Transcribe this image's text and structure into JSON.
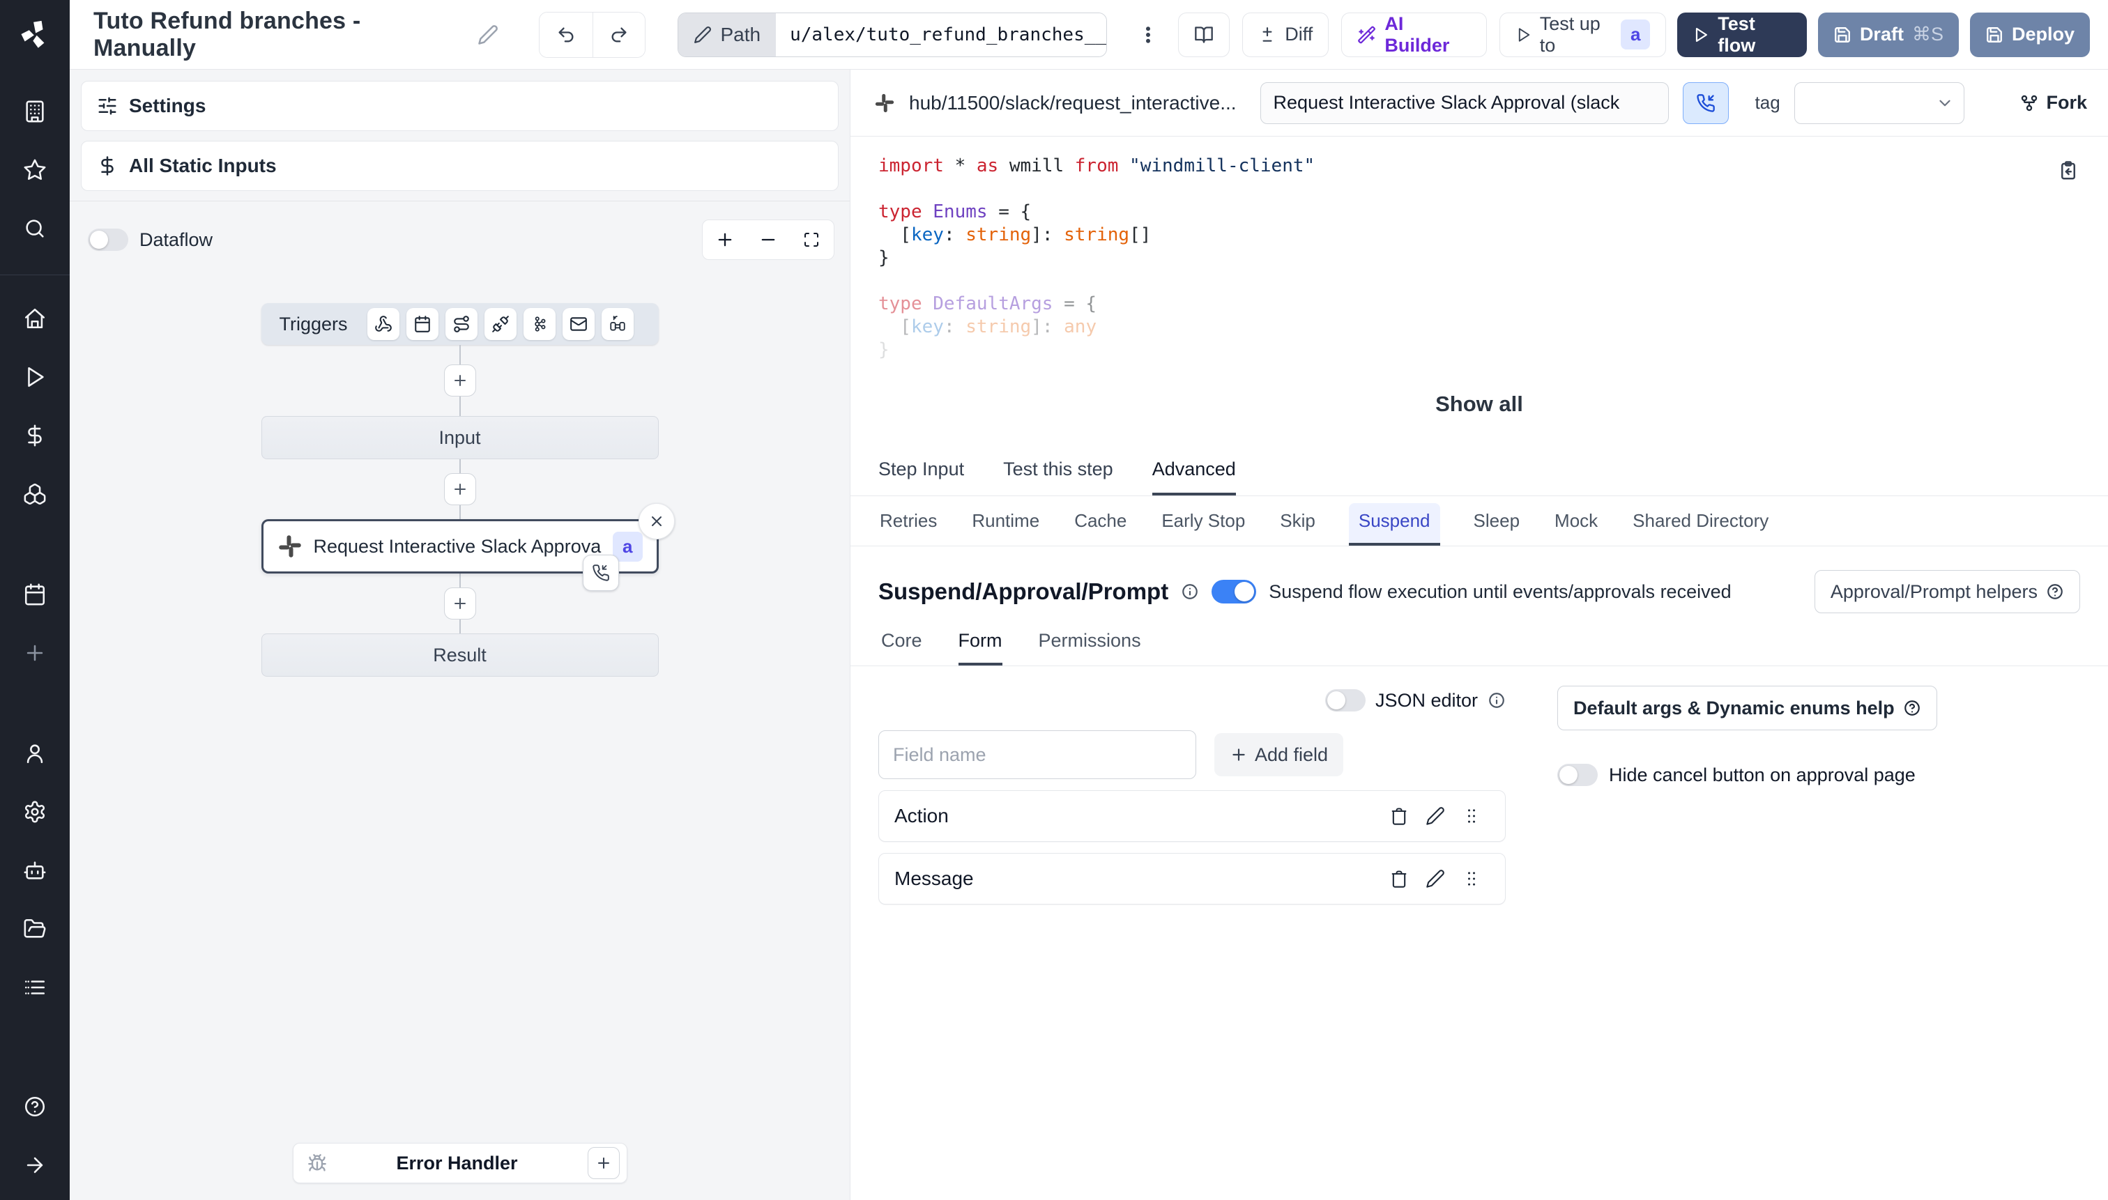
{
  "topbar": {
    "title": "Tuto Refund branches - Manually",
    "path_label": "Path",
    "path_value": "u/alex/tuto_refund_branches__",
    "diff_label": "Diff",
    "ai_builder_label": "AI Builder",
    "test_up_to_label": "Test up to",
    "test_up_to_badge": "a",
    "test_flow_label": "Test flow",
    "draft_label": "Draft",
    "draft_shortcut": "⌘S",
    "deploy_label": "Deploy"
  },
  "flow_panel": {
    "settings_label": "Settings",
    "all_static_inputs_label": "All Static Inputs",
    "dataflow_label": "Dataflow",
    "triggers_label": "Triggers",
    "input_node_label": "Input",
    "step_node_label": "Request Interactive Slack Approval (...",
    "step_node_badge": "a",
    "result_node_label": "Result",
    "error_handler_label": "Error Handler"
  },
  "step_panel": {
    "hub_path": "hub/11500/slack/request_interactive...",
    "summary_value": "Request Interactive Slack Approval (slack",
    "tag_label": "tag",
    "fork_label": "Fork",
    "show_all_label": "Show all",
    "tabs": [
      "Step Input",
      "Test this step",
      "Advanced"
    ],
    "advanced_tabs": [
      "Retries",
      "Runtime",
      "Cache",
      "Early Stop",
      "Skip",
      "Suspend",
      "Sleep",
      "Mock",
      "Shared Directory"
    ],
    "suspend": {
      "heading": "Suspend/Approval/Prompt",
      "toggle_description": "Suspend flow execution until events/approvals received",
      "helpers_button_label": "Approval/Prompt helpers"
    },
    "form": {
      "sub_tabs": [
        "Core",
        "Form",
        "Permissions"
      ],
      "json_editor_label": "JSON editor",
      "field_name_placeholder": "Field name",
      "add_field_label": "Add field",
      "default_args_button_label": "Default args & Dynamic enums help",
      "hide_cancel_label": "Hide cancel button on approval page",
      "fields": [
        "Action",
        "Message"
      ]
    },
    "code": {
      "lines": [
        {
          "opacity": 1,
          "tokens": [
            [
              "kw",
              "import"
            ],
            [
              "pl",
              " * "
            ],
            [
              "kw",
              "as"
            ],
            [
              "pl",
              " wmill "
            ],
            [
              "kw",
              "from"
            ],
            [
              "str",
              " \"windmill-client\""
            ]
          ]
        },
        {
          "opacity": 1,
          "tokens": []
        },
        {
          "opacity": 1,
          "tokens": [
            [
              "kw",
              "type"
            ],
            [
              "type",
              " Enums"
            ],
            [
              "pl",
              " = {"
            ]
          ]
        },
        {
          "opacity": 1,
          "tokens": [
            [
              "pl",
              "  ["
            ],
            [
              "var",
              "key"
            ],
            [
              "pl",
              ": "
            ],
            [
              "orange",
              "string"
            ],
            [
              "pl",
              "]: "
            ],
            [
              "orange",
              "string"
            ],
            [
              "pl",
              "[]"
            ]
          ]
        },
        {
          "opacity": 1,
          "tokens": [
            [
              "pl",
              "}"
            ]
          ]
        },
        {
          "opacity": 1,
          "tokens": []
        },
        {
          "opacity": 0.5,
          "tokens": [
            [
              "kw",
              "type"
            ],
            [
              "type",
              " DefaultArgs"
            ],
            [
              "pl",
              " = {"
            ]
          ]
        },
        {
          "opacity": 0.33,
          "tokens": [
            [
              "pl",
              "  ["
            ],
            [
              "var",
              "key"
            ],
            [
              "pl",
              ": "
            ],
            [
              "orange",
              "string"
            ],
            [
              "pl",
              "]: "
            ],
            [
              "orange",
              "any"
            ]
          ]
        },
        {
          "opacity": 0.15,
          "tokens": [
            [
              "pl",
              "}"
            ]
          ]
        }
      ]
    }
  },
  "colors": {
    "accent_blue": "#3b82f6",
    "navy_button": "#2e3a57",
    "slate_button": "#6e84a8",
    "ai_purple": "#6d28d9",
    "badge_bg": "#e0e7ff",
    "badge_text": "#4f46e5",
    "suspend_tab_blue": "#3946c5",
    "rail_bg": "#1e222b"
  }
}
